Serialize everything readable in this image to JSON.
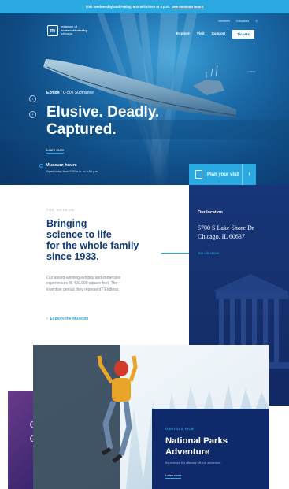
{
  "alert": {
    "text": "This Wednesday and Friday, MSI will close at 4 p.m.",
    "link": "See Museum hours"
  },
  "logo": {
    "line1": "museum of",
    "line2": "science+industry",
    "line3": "chicago"
  },
  "nav_top": [
    "Members",
    "Educators"
  ],
  "nav_main": [
    "Explore",
    "Visit",
    "Support"
  ],
  "tickets_label": "Tickets",
  "hero": {
    "eyebrow_strong": "Exhibit",
    "eyebrow_rest": "/ U-505 Submarine",
    "headline_line1": "Elusive. Deadly.",
    "headline_line2": "Captured.",
    "learn_more": "Learn more",
    "side_label": "Video"
  },
  "hours": {
    "title": "Museum hours",
    "detail": "Open today from 9:30 a.m. to 5:30 p.m."
  },
  "plan_visit": "Plan your visit",
  "museum": {
    "kicker": "THE MUSEUM",
    "headline_1": "Bringing",
    "headline_2": "science to life",
    "headline_3": "for the whole family",
    "headline_4": "since 1933.",
    "body": "Our award-winning exhibits and immersive experiences fill 400,000 square feet. The inventive genius they represent? Endless.",
    "explore": "Explore the Museum"
  },
  "location": {
    "label": "Our location",
    "address_1": "5700 S Lake Shore Dr",
    "address_2": "Chicago, IL 60637",
    "directions": "Get directions"
  },
  "feature": {
    "kicker": "OMNIMAX FILM",
    "title_1": "National Parks",
    "title_2": "Adventure",
    "desc": "Experience the ultimate off-trail adventure.",
    "link": "Learn more"
  }
}
